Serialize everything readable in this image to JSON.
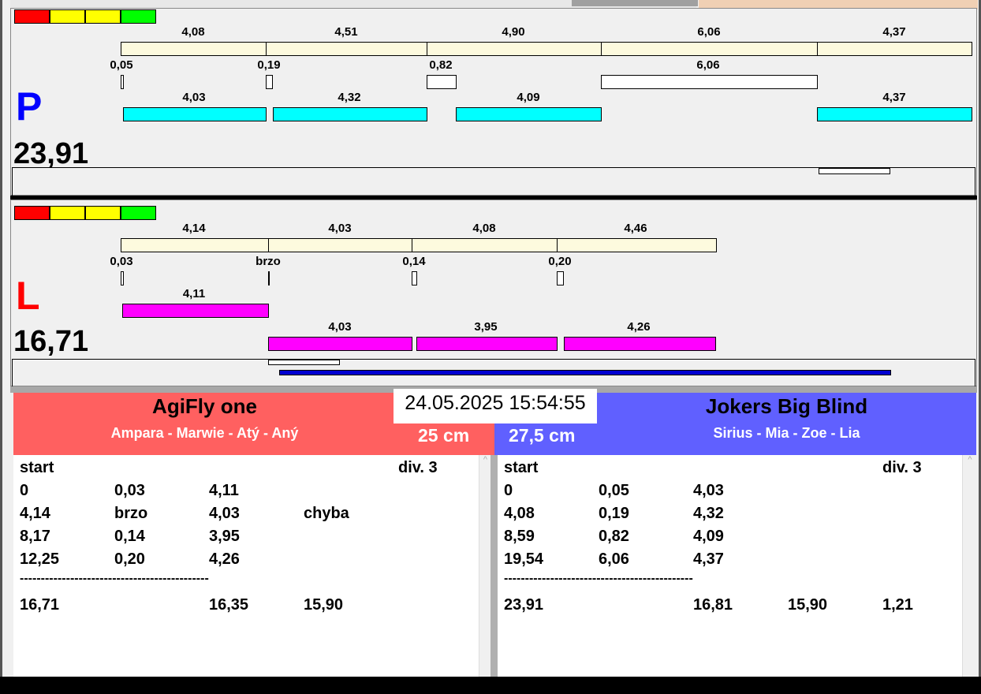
{
  "status_colors": [
    "#ff0000",
    "#ffff00",
    "#ffff00",
    "#00ff00"
  ],
  "P": {
    "letter": "P",
    "total": "23,91",
    "row1": [
      "4,08",
      "4,51",
      "4,90",
      "6,06",
      "4,37"
    ],
    "row2": [
      "0,05",
      "0,19",
      "0,82",
      "6,06"
    ],
    "row3": [
      "4,03",
      "4,32",
      "4,09",
      "4,37"
    ]
  },
  "L": {
    "letter": "L",
    "total": "16,71",
    "row1": [
      "4,14",
      "4,03",
      "4,08",
      "4,46"
    ],
    "row2": [
      "0,03",
      "brzo",
      "0,14",
      "0,20"
    ],
    "row3": [
      "4,11"
    ],
    "row4": [
      "4,03",
      "3,95",
      "4,26"
    ]
  },
  "datetime": "24.05.2025 15:54:55",
  "left_team": {
    "name": "AgiFly one",
    "members": "Ampara - Marwie - Atý - Aný",
    "height": "25 cm",
    "color": "#ff6060",
    "header": {
      "start": "start",
      "div": "div.  3"
    },
    "rows": [
      [
        "0",
        "0,03",
        "4,11",
        ""
      ],
      [
        "4,14",
        "brzo",
        "4,03",
        "chyba"
      ],
      [
        "8,17",
        "0,14",
        "3,95",
        ""
      ],
      [
        "12,25",
        "0,20",
        "4,26",
        ""
      ]
    ],
    "separator": "---------------------------------------------",
    "totals": [
      "16,71",
      "16,35",
      "15,90",
      ""
    ]
  },
  "right_team": {
    "name": "Jokers Big Blind",
    "members": "Sirius - Mia - Zoe - Lia",
    "height": "27,5 cm",
    "color": "#6060ff",
    "header": {
      "start": "start",
      "div": "div.  3"
    },
    "rows": [
      [
        "0",
        "0,05",
        "4,03"
      ],
      [
        "4,08",
        "0,19",
        "4,32"
      ],
      [
        "8,59",
        "0,82",
        "4,09"
      ],
      [
        "19,54",
        "6,06",
        "4,37"
      ]
    ],
    "separator": "---------------------------------------------",
    "totals": [
      "23,91",
      "16,81",
      "15,90",
      "1,21"
    ]
  }
}
